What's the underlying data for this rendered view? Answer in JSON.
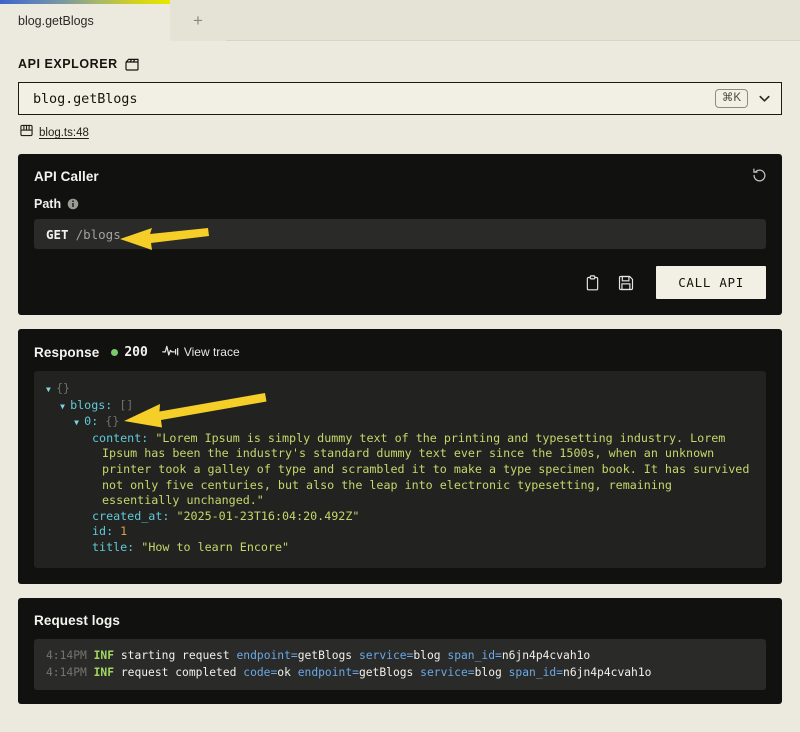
{
  "window": {
    "tabs": [
      {
        "label": "blog.getBlogs",
        "active": true
      }
    ],
    "new_tab_label": "+",
    "accent_gradient": [
      "#3f63c9",
      "#7d9a9c",
      "#e8e800"
    ]
  },
  "explorer": {
    "heading": "API EXPLORER",
    "heading_icon": "clapperboard-icon",
    "endpoint_selector": {
      "value": "blog.getBlogs",
      "shortcut": "⌘K",
      "chevron_icon": "chevron-down-icon"
    },
    "source_link": {
      "icon": "source-file-icon",
      "label": "blog.ts:48"
    }
  },
  "api_caller": {
    "title": "API Caller",
    "reset_icon": "reset-icon",
    "path_label": "Path",
    "info_icon": "info-icon",
    "request": {
      "method": "GET",
      "route": "/blogs"
    },
    "actions": {
      "copy_icon": "clipboard-icon",
      "save_icon": "save-disk-icon",
      "call_label": "CALL API"
    }
  },
  "response": {
    "title": "Response",
    "status_dot_color": "#7bc96f",
    "status_code": "200",
    "trace_icon": "activity-pulse-icon",
    "trace_label": "View trace",
    "json": {
      "root_brace": "{}",
      "blogs_key": "blogs:",
      "blogs_brace": "[]",
      "index_key": "0:",
      "index_brace": "{}",
      "content_key": "content:",
      "content_value": "\"Lorem Ipsum is simply dummy text of the printing and typesetting industry. Lorem Ipsum has been the industry's standard dummy text ever since the 1500s, when an unknown printer took a galley of type and scrambled it to make a type specimen book. It has survived not only five centuries, but also the leap into electronic typesetting, remaining essentially unchanged.\"",
      "created_at_key": "created_at:",
      "created_at_value": "\"2025-01-23T16:04:20.492Z\"",
      "id_key": "id:",
      "id_value": "1",
      "title_key": "title:",
      "title_value": "\"How to learn Encore\""
    }
  },
  "request_logs": {
    "title": "Request logs",
    "entries": [
      {
        "time": "4:14PM",
        "level": "INF",
        "message": "starting request",
        "fields": [
          {
            "key": "endpoint=",
            "value": "getBlogs"
          },
          {
            "key": "service=",
            "value": "blog"
          },
          {
            "key": "span_id=",
            "value": "n6jn4p4cvah1o"
          }
        ]
      },
      {
        "time": "4:14PM",
        "level": "INF",
        "message": "request completed",
        "fields": [
          {
            "key": "code=",
            "value": "ok"
          },
          {
            "key": "endpoint=",
            "value": "getBlogs"
          },
          {
            "key": "service=",
            "value": "blog"
          },
          {
            "key": "span_id=",
            "value": "n6jn4p4cvah1o"
          }
        ]
      }
    ]
  },
  "annotations": {
    "color": "#f5cf28",
    "arrows": [
      {
        "name": "arrow-pointing-to-path-input"
      },
      {
        "name": "arrow-pointing-to-blogs-array"
      }
    ]
  }
}
